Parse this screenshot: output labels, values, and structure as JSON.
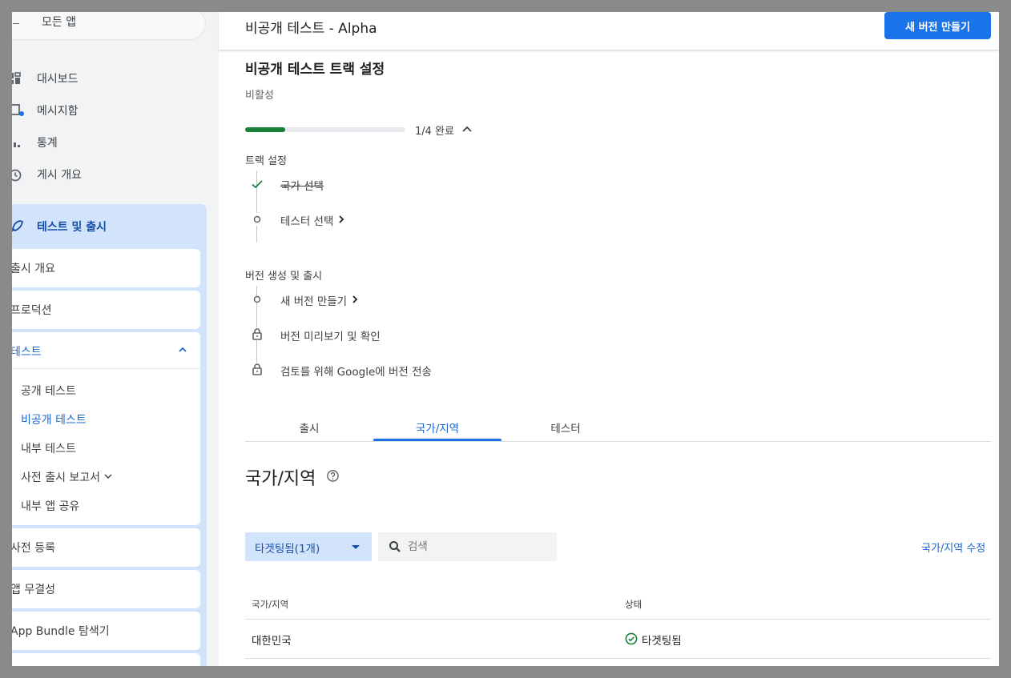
{
  "sidebar": {
    "all_apps": "모든 앱",
    "items": [
      {
        "label": "대시보드",
        "icon": "dashboard-icon"
      },
      {
        "label": "메시지함",
        "icon": "inbox-icon"
      },
      {
        "label": "통계",
        "icon": "bar-chart-icon"
      },
      {
        "label": "게시 개요",
        "icon": "clock-icon"
      }
    ],
    "test_release": {
      "label": "테스트 및 출시",
      "icon": "rocket-icon",
      "cards": [
        "출시 개요",
        "프로덕션"
      ],
      "testing": {
        "label": "테스트",
        "sub": [
          "공개 테스트",
          "비공개 테스트",
          "내부 테스트",
          "사전 출시 보고서",
          "내부 앱 공유"
        ]
      },
      "more": [
        "사전 등록",
        "앱 무결성",
        "App Bundle 탐색기"
      ]
    }
  },
  "header": {
    "title": "비공개 테스트 - Alpha",
    "new_release_button": "새 버전 만들기"
  },
  "setup": {
    "title": "비공개 테스트 트랙 설정",
    "status": "비활성",
    "progress_fraction": 0.25,
    "progress_text": "1/4 완료",
    "group1_label": "트랙 설정",
    "steps1": [
      "국가 선택",
      "테스터 선택"
    ],
    "group2_label": "버전 생성 및 출시",
    "steps2": [
      "새 버전 만들기",
      "버전 미리보기 및 확인",
      "검토를 위해 Google에 버전 전송"
    ]
  },
  "tabs": [
    "출시",
    "국가/지역",
    "테스터"
  ],
  "active_tab": "국가/지역",
  "region": {
    "title": "국가/지역",
    "filter_label": "타겟팅됨(1개)",
    "search_placeholder": "검색",
    "edit_link": "국가/지역 수정",
    "columns": [
      "국가/지역",
      "상태"
    ],
    "rows": [
      {
        "country": "대한민국",
        "status": "타겟팅됨"
      }
    ]
  },
  "colors": {
    "primary": "#1a73e8",
    "success": "#188038",
    "active_nav_bg": "#d2e3fc"
  }
}
